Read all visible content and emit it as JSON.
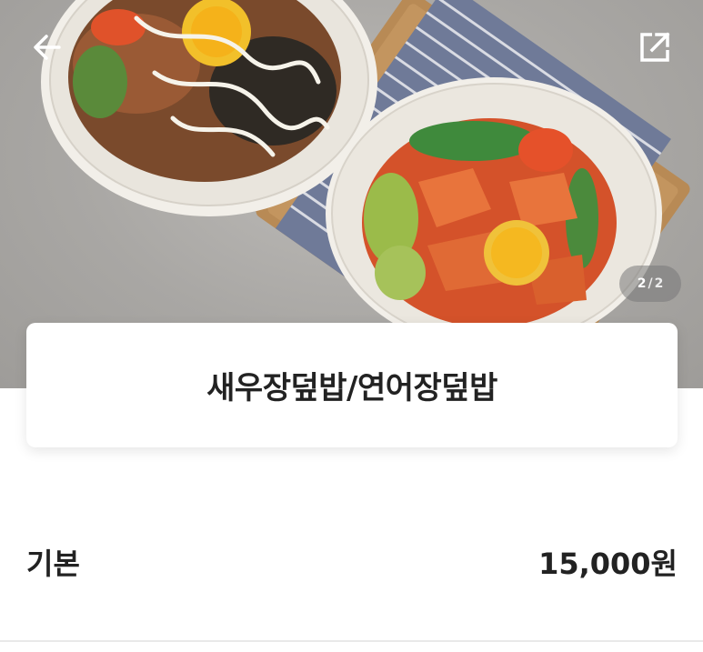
{
  "header": {
    "back_icon": "arrow-left-icon",
    "share_icon": "share-external-icon"
  },
  "gallery": {
    "current_page": "2",
    "separator": "/",
    "total_pages": "2"
  },
  "product": {
    "title": "새우장덮밥/연어장덮밥"
  },
  "options": [
    {
      "label": "기본",
      "price": "15,000원"
    }
  ],
  "colors": {
    "text": "#222222",
    "card_bg": "#ffffff",
    "indicator_bg": "#787878"
  }
}
